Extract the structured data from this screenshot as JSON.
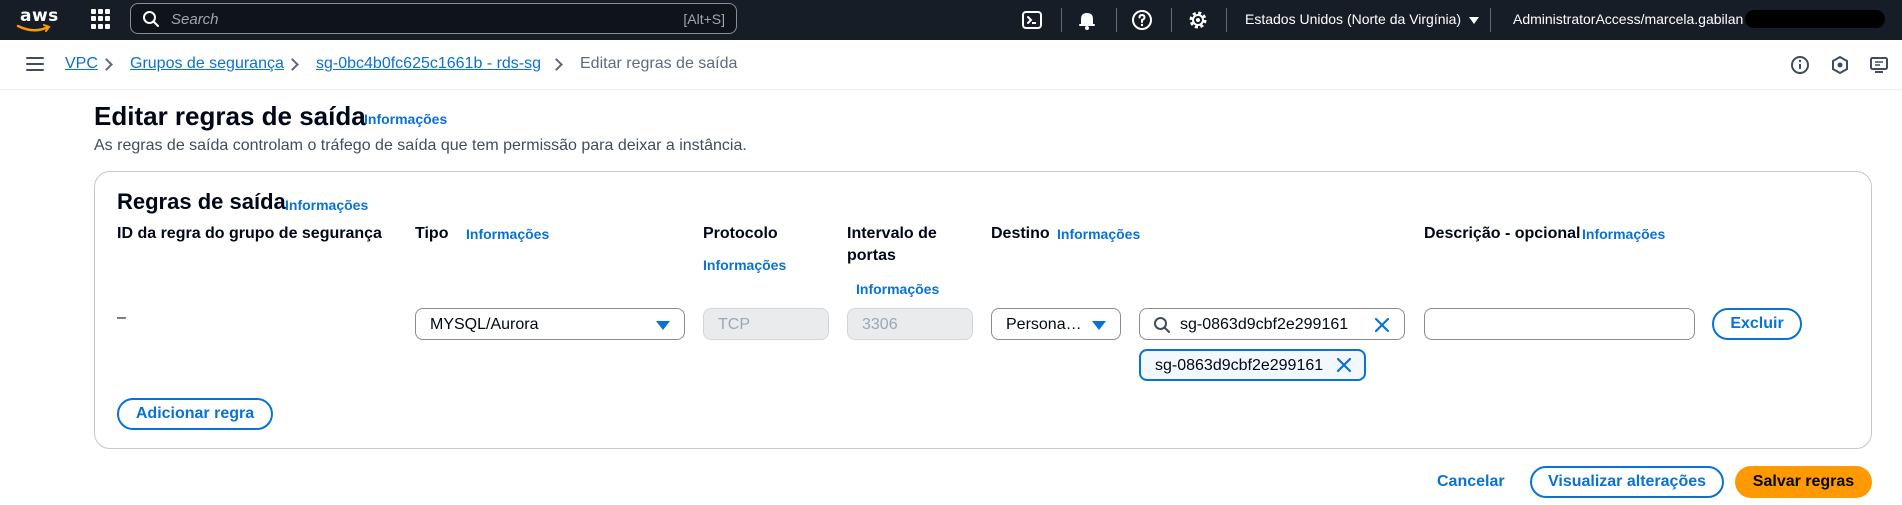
{
  "topbar": {
    "logo_text": "aws",
    "search_placeholder": "Search",
    "search_shortcut": "[Alt+S]",
    "region": "Estados Unidos (Norte da Virgínia)",
    "account": "AdministratorAccess/marcela.gabilan"
  },
  "breadcrumb": {
    "items": [
      "VPC",
      "Grupos de segurança",
      "sg-0bc4b0fc625c1661b - rds-sg"
    ],
    "current": "Editar regras de saída"
  },
  "header": {
    "title": "Editar regras de saída",
    "info": "Informações",
    "description": "As regras de saída controlam o tráfego de saída que tem permissão para deixar a instância."
  },
  "panel": {
    "title": "Regras de saída",
    "info": "Informações",
    "columns": {
      "rule_id": "ID da regra do grupo de segurança",
      "type": "Tipo",
      "type_info": "Informações",
      "protocol": "Protocolo",
      "protocol_info": "Informações",
      "port_range_line1": "Intervalo de",
      "port_range_line2": "portas",
      "port_range_info": "Informações",
      "destination": "Destino",
      "destination_info": "Informações",
      "description": "Descrição - opcional",
      "description_info": "Informações"
    },
    "row": {
      "rule_id": "–",
      "type": "MYSQL/Aurora",
      "protocol": "TCP",
      "port_range": "3306",
      "destination_type": "Persona…",
      "destination_search": "sg-0863d9cbf2e299161",
      "destination_token": "sg-0863d9cbf2e299161",
      "description": "",
      "delete": "Excluir"
    },
    "add_rule": "Adicionar regra"
  },
  "footer": {
    "cancel": "Cancelar",
    "preview": "Visualizar alterações",
    "save": "Salvar regras"
  },
  "colors": {
    "topbar_bg": "#161d26",
    "link": "#0972d3",
    "primary": "#ff9900"
  }
}
